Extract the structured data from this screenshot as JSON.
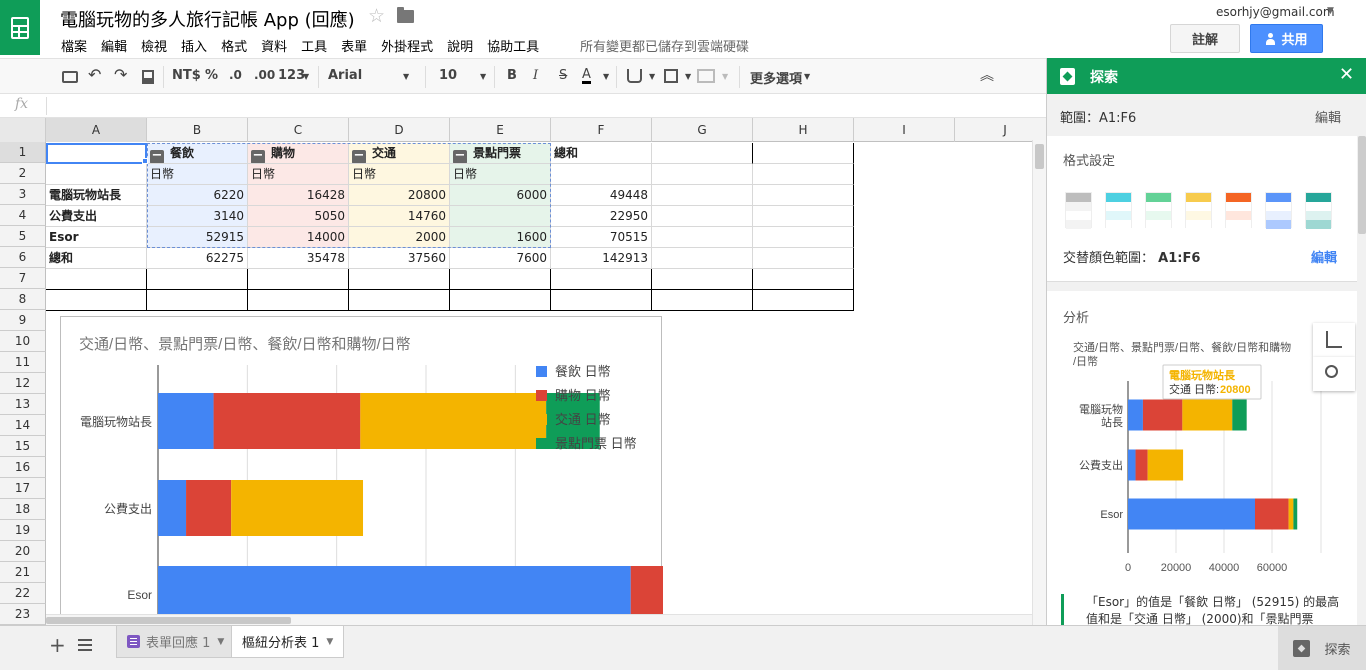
{
  "header": {
    "title": "電腦玩物的多人旅行記帳 App (回應)",
    "menus": [
      "檔案",
      "編輯",
      "檢視",
      "插入",
      "格式",
      "資料",
      "工具",
      "表單",
      "外掛程式",
      "說明",
      "協助工具"
    ],
    "save_status": "所有變更都已儲存到雲端硬碟",
    "account": "esorhjy@gmail.com",
    "comments": "註解",
    "share": "共用"
  },
  "toolbar": {
    "currency": "NT$",
    "percent": "%",
    "dec_less": ".0",
    "dec_more": ".00",
    "number_format": "123",
    "font": "Arial",
    "font_size": "10",
    "bold": "B",
    "italic": "I",
    "strike": "S",
    "text_color": "A",
    "more": "更多選項"
  },
  "formula": {
    "fx": "fx",
    "value": ""
  },
  "grid": {
    "columns": [
      "A",
      "B",
      "C",
      "D",
      "E",
      "F",
      "G",
      "H",
      "I",
      "J"
    ],
    "rows": [
      "1",
      "2",
      "3",
      "4",
      "5",
      "6",
      "7",
      "8",
      "9",
      "10",
      "11",
      "12",
      "13",
      "14",
      "15",
      "16",
      "17",
      "18",
      "19",
      "20",
      "21",
      "22",
      "23"
    ],
    "cells": {
      "B1": "餐飲",
      "C1": "購物",
      "D1": "交通",
      "E1": "景點門票",
      "F1": "總和",
      "B2": "日幣",
      "C2": "日幣",
      "D2": "日幣",
      "E2": "日幣",
      "A3": "電腦玩物站長",
      "B3": "6220",
      "C3": "16428",
      "D3": "20800",
      "E3": "6000",
      "F3": "49448",
      "A4": "公費支出",
      "B4": "3140",
      "C4": "5050",
      "D4": "14760",
      "E4": "",
      "F4": "22950",
      "A5": "Esor",
      "B5": "52915",
      "C5": "14000",
      "D5": "2000",
      "E5": "1600",
      "F5": "70515",
      "A6": "總和",
      "B6": "62275",
      "C6": "35478",
      "D6": "37560",
      "E6": "7600",
      "F6": "142913"
    }
  },
  "chart_data": [
    {
      "type": "bar",
      "stacked": true,
      "orientation": "horizontal",
      "title": "交通/日幣、景點門票/日幣、餐飲/日幣和購物/日幣",
      "categories": [
        "電腦玩物站長",
        "公費支出",
        "Esor"
      ],
      "series": [
        {
          "name": "餐飲 日幣",
          "color": "#4285f4",
          "values": [
            6220,
            3140,
            52915
          ]
        },
        {
          "name": "購物 日幣",
          "color": "#db4437",
          "values": [
            16428,
            5050,
            14000
          ]
        },
        {
          "name": "交通 日幣",
          "color": "#f4b400",
          "values": [
            20800,
            14760,
            2000
          ]
        },
        {
          "name": "景點門票 日幣",
          "color": "#0f9d58",
          "values": [
            6000,
            0,
            1600
          ]
        }
      ],
      "xlim": [
        0,
        80000
      ],
      "legend": "right",
      "grid": true
    },
    {
      "type": "bar",
      "stacked": true,
      "orientation": "horizontal",
      "title": "交通/日幣、景點門票/日幣、餐飲/日幣和購物/日幣",
      "categories": [
        "電腦玩物站長",
        "公費支出",
        "Esor"
      ],
      "series": [
        {
          "color": "#4285f4",
          "values": [
            6220,
            3140,
            52915
          ]
        },
        {
          "color": "#db4437",
          "values": [
            16428,
            5050,
            14000
          ]
        },
        {
          "color": "#f4b400",
          "values": [
            20800,
            14760,
            2000
          ]
        },
        {
          "color": "#0f9d58",
          "values": [
            6000,
            0,
            1600
          ]
        }
      ],
      "xlim": [
        0,
        80000
      ],
      "xticks": [
        "0",
        "20000",
        "40000",
        "60000"
      ],
      "tooltip": {
        "title": "電腦玩物站長",
        "label": "交通 日幣:",
        "value": "20800"
      }
    }
  ],
  "explore": {
    "title": "探索",
    "close": "✕",
    "range": "範圍：A1:F6",
    "edit": "編輯",
    "format_title": "格式設定",
    "alt_label": "交替顏色範圍：",
    "alt_range": "A1:F6",
    "alt_edit": "編輯",
    "analysis_title": "分析",
    "insight": "「Esor」的值是「餐飲 日幣」 (52915) 的最高值和是「交通 日幣」 (2000)和「景點門票"
  },
  "tabs": {
    "add": "+",
    "sheet1": "表單回應 1",
    "sheet2": "樞紐分析表 1",
    "explore": "探索"
  },
  "colors": {
    "green": "#0f9d58",
    "blue": "#4285f4",
    "red": "#db4437",
    "yellow": "#f4b400"
  }
}
